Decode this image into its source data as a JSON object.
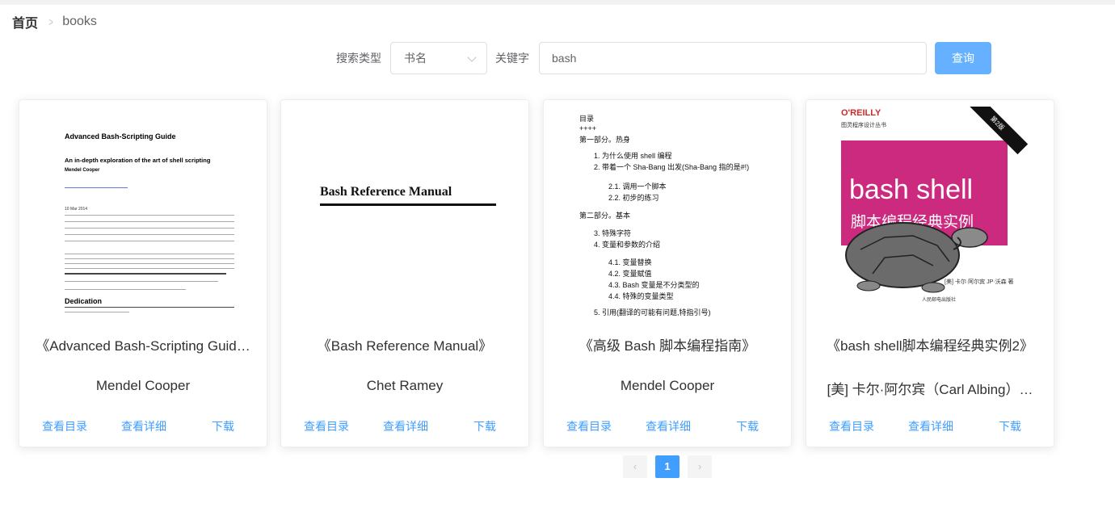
{
  "breadcrumb": {
    "home": "首页",
    "current": "books"
  },
  "search": {
    "type_label": "搜索类型",
    "type_value": "书名",
    "keyword_label": "关键字",
    "keyword_value": "bash",
    "button_label": "查询"
  },
  "cards": [
    {
      "title": "《Advanced Bash-Scripting Guid…",
      "author": "Mendel Cooper",
      "toc_link": "查看目录",
      "detail_link": "查看详细",
      "download_link": "下载"
    },
    {
      "title": "《Bash Reference Manual》",
      "author": "Chet Ramey",
      "toc_link": "查看目录",
      "detail_link": "查看详细",
      "download_link": "下载"
    },
    {
      "title": "《高级 Bash 脚本编程指南》",
      "author": "Mendel Cooper",
      "toc_link": "查看目录",
      "detail_link": "查看详细",
      "download_link": "下载"
    },
    {
      "title": "《bash shell脚本编程经典实例2》",
      "author": "[美] 卡尔·阿尔宾（Carl Albing）…",
      "toc_link": "查看目录",
      "detail_link": "查看详细",
      "download_link": "下载"
    }
  ],
  "covers": {
    "abs": {
      "title": "Advanced Bash-Scripting Guide",
      "subtitle": "An in-depth exploration of the art of shell scripting",
      "author": "Mendel Cooper",
      "date": "10 Mar 2014",
      "section": "Dedication"
    },
    "brm": {
      "title": "Bash Reference Manual"
    },
    "cn_toc": {
      "lines": [
        "目录",
        "++++",
        "第一部分。热身",
        "1. 为什么使用 shell 编程",
        "2. 带着一个 Sha-Bang 出发(Sha-Bang 指的是#!)",
        "2.1. 调用一个脚本",
        "2.2. 初步的练习",
        "第二部分。基本",
        "3. 特殊字符",
        "4. 变量和参数的介绍",
        "4.1. 变量替换",
        "4.2. 变量赋值",
        "4.3. Bash 变量是不分类型的",
        "4.4. 特殊的变量类型",
        "5. 引用(翻译的可能有问题,特指引号)"
      ]
    },
    "cookbook": {
      "publisher": "O'REILLY",
      "series": "图灵程序设计丛书",
      "edition": "第2版",
      "title_en": "bash shell",
      "title_cn": "脚本编程经典实例",
      "translator": "[美] 卡尔·阿尔宾 JP·沃森 著",
      "press": "人民邮电出版社"
    }
  },
  "pagination": {
    "prev": "‹",
    "current": "1",
    "next": "›"
  },
  "colors": {
    "primary": "#409eff",
    "button_light": "#66b1ff",
    "cover_pink": "#cc2a7f"
  }
}
